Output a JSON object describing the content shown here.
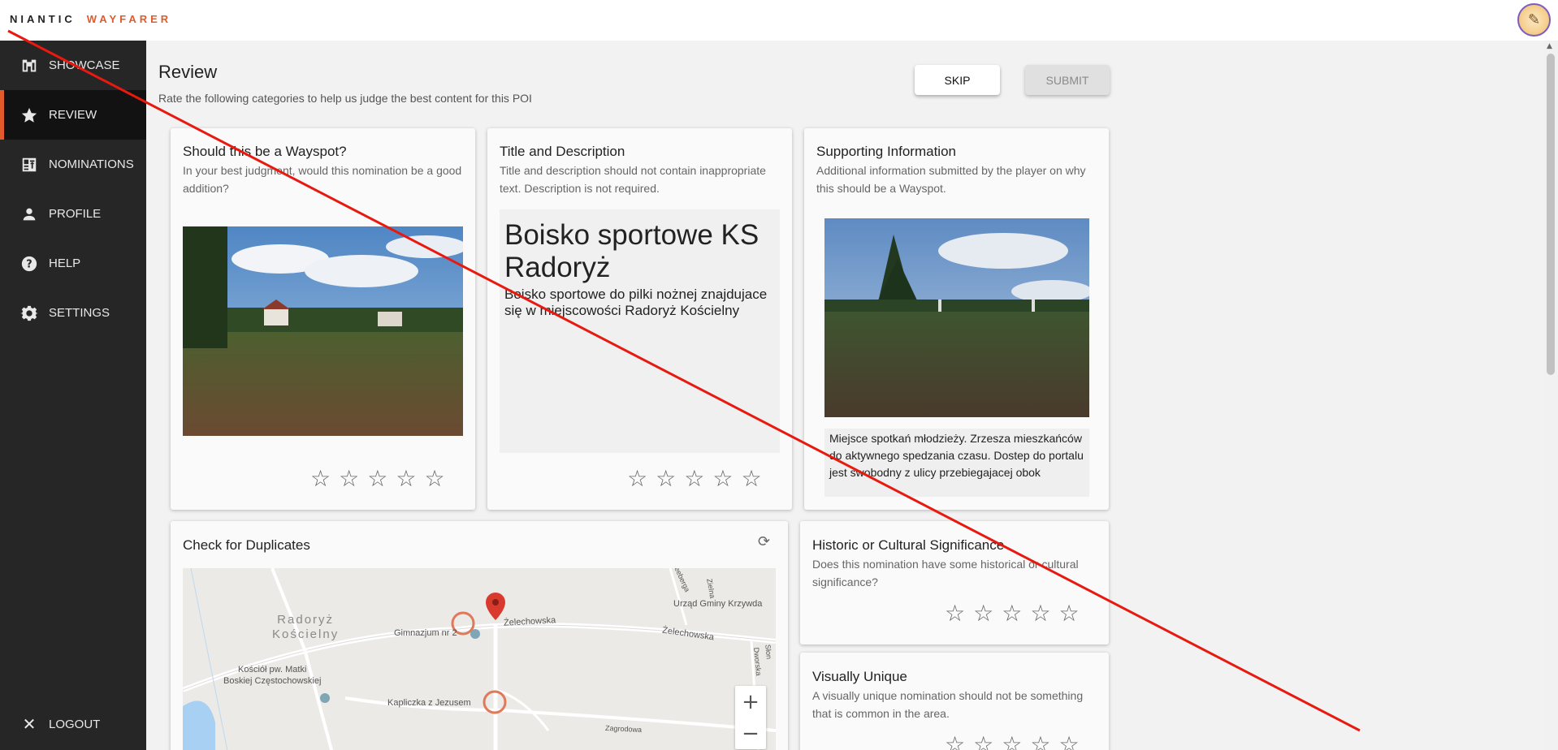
{
  "header": {
    "logo_part1": "NIANTIC",
    "logo_part2": "WAYFARER",
    "avatar_icon": "✎"
  },
  "sidebar": {
    "items": [
      {
        "label": "SHOWCASE",
        "icon": "binoculars-icon"
      },
      {
        "label": "REVIEW",
        "icon": "star-icon"
      },
      {
        "label": "NOMINATIONS",
        "icon": "nominations-icon"
      },
      {
        "label": "PROFILE",
        "icon": "person-icon"
      },
      {
        "label": "HELP",
        "icon": "help-icon"
      },
      {
        "label": "SETTINGS",
        "icon": "gear-icon"
      }
    ],
    "logout_label": "LOGOUT"
  },
  "main": {
    "title": "Review",
    "subtitle": "Rate the following categories to help us judge the best content for this POI",
    "skip_label": "SKIP",
    "submit_label": "SUBMIT"
  },
  "cards": {
    "wayspot": {
      "title": "Should this be a Wayspot?",
      "desc": "In your best judgment, would this nomination be a good addition?"
    },
    "title_desc": {
      "title": "Title and Description",
      "desc": "Title and description should not contain inappropriate text. Description is not required.",
      "poi_title": "Boisko sportowe KS Radoryż",
      "poi_desc": "Boisko sportowe do pilki nożnej znajdujace się w miejscowości Radoryż Kościelny"
    },
    "supporting": {
      "title": "Supporting Information",
      "desc": "Additional information submitted by the player on why this should be a Wayspot.",
      "text": "Miejsce spotkań młodzieży. Zrzesza mieszkańców do aktywnego spedzania czasu. Dostep do portalu jest swobodny z ulicy przebiegajacej obok"
    },
    "duplicates": {
      "title": "Check for Duplicates",
      "map_labels": {
        "town": "Radoryż\nKościelny",
        "gimnazjum": "Gimnazjum nr 2",
        "zelechowska1": "Żelechowska",
        "zelechowska2": "Żelechowska",
        "urzad": "Urząd Gminy Krzywda",
        "kosciol": "Kościół pw. Matki\nBoskiej Częstochowskiej",
        "kapliczka": "Kapliczka z Jezusem",
        "zagrodowa": "Zagrodowa",
        "zielna": "Zielna",
        "seeberga": "Seeberga",
        "dworska": "Dworska",
        "sloneczna": "Słon"
      },
      "zoom_in": "+",
      "zoom_out": "−"
    },
    "historic": {
      "title": "Historic or Cultural Significance",
      "desc": "Does this nomination have some historical or cultural significance?"
    },
    "unique": {
      "title": "Visually Unique",
      "desc": "A visually unique nomination should not be something that is common in the area."
    }
  },
  "rating_glyph": "☆"
}
